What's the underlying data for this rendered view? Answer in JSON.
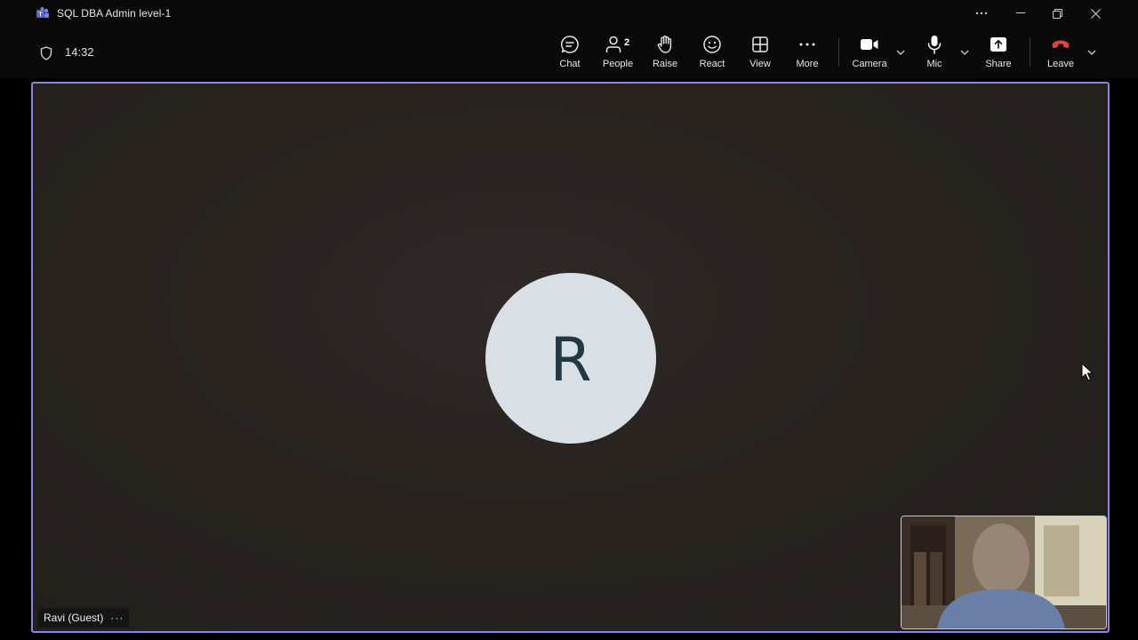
{
  "window": {
    "title": "SQL DBA Admin level-1",
    "app_icon": "teams-icon",
    "controls": [
      "more-options-icon",
      "minimize-icon",
      "restore-icon",
      "close-icon"
    ]
  },
  "meeting": {
    "elapsed_time": "14:32"
  },
  "toolbar": {
    "chat_label": "Chat",
    "people_label": "People",
    "people_count": "2",
    "raise_label": "Raise",
    "react_label": "React",
    "view_label": "View",
    "more_label": "More",
    "camera_label": "Camera",
    "mic_label": "Mic",
    "share_label": "Share",
    "leave_label": "Leave"
  },
  "stage": {
    "participant_initial": "R",
    "participant_name": "Ravi (Guest)",
    "participant_menu": "···"
  },
  "colors": {
    "accent_border": "#8b87d8",
    "leave_red": "#e0443e",
    "avatar_bg": "#d8e0e6",
    "avatar_text": "#233846"
  }
}
